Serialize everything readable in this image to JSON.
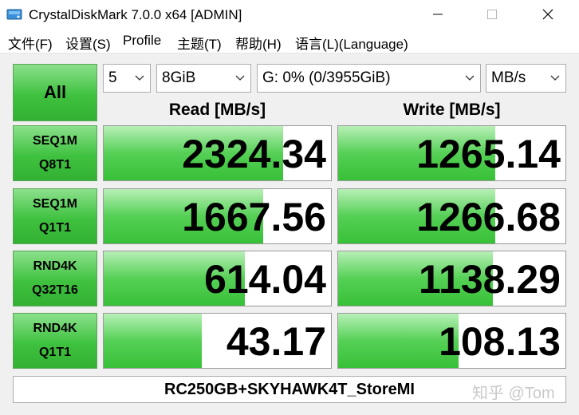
{
  "window": {
    "title": "CrystalDiskMark 7.0.0 x64 [ADMIN]",
    "icon": "crystaldiskmark-app-icon"
  },
  "menu": [
    {
      "label": "文件(F)"
    },
    {
      "label": "设置(S)"
    },
    {
      "label": "Profile"
    },
    {
      "label": "主题(T)"
    },
    {
      "label": "帮助(H)"
    },
    {
      "label": "语言(L)(Language)"
    }
  ],
  "toolbar": {
    "all_label": "All",
    "count": "5",
    "size": "8GiB",
    "drive": "G: 0% (0/3955GiB)",
    "unit": "MB/s"
  },
  "headers": {
    "read": "Read [MB/s]",
    "write": "Write [MB/s]"
  },
  "tests": [
    {
      "line1": "SEQ1M",
      "line2": "Q8T1",
      "read": "2324.34",
      "write": "1265.14",
      "read_fill": 0.79,
      "write_fill": 0.69
    },
    {
      "line1": "SEQ1M",
      "line2": "Q1T1",
      "read": "1667.56",
      "write": "1266.68",
      "read_fill": 0.7,
      "write_fill": 0.69
    },
    {
      "line1": "RND4K",
      "line2": "Q32T16",
      "read": "614.04",
      "write": "1138.29",
      "read_fill": 0.62,
      "write_fill": 0.68
    },
    {
      "line1": "RND4K",
      "line2": "Q1T1",
      "read": "43.17",
      "write": "108.13",
      "read_fill": 0.43,
      "write_fill": 0.53
    }
  ],
  "comment": "RC250GB+SKYHAWK4T_StoreMI",
  "watermark": "知乎 @Tom",
  "colors": {
    "bar_green": "#38c038",
    "button_green": "#3fc23f"
  }
}
